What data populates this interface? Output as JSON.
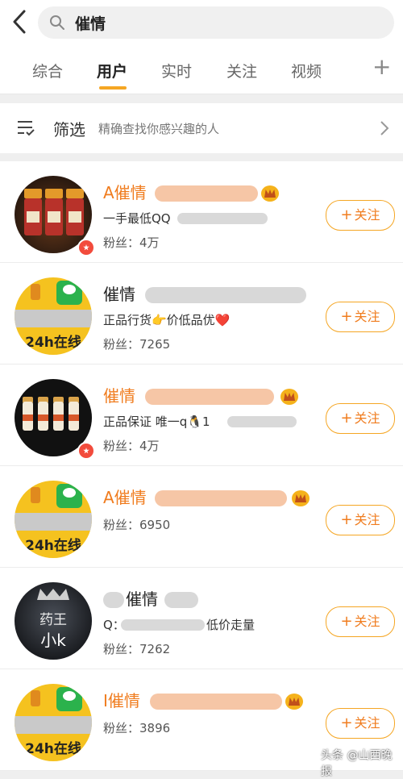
{
  "search": {
    "query": "催情"
  },
  "tabs": [
    {
      "label": "综合",
      "active": false
    },
    {
      "label": "用户",
      "active": true
    },
    {
      "label": "实时",
      "active": false
    },
    {
      "label": "关注",
      "active": false
    },
    {
      "label": "视频",
      "active": false
    }
  ],
  "tab_plus": "+",
  "filter": {
    "title": "筛选",
    "description": "精确查找你感兴趣的人"
  },
  "follow_label": "关注",
  "follow_plus": "+",
  "avatar_texts": {
    "online": "24h在线",
    "yao_line1": "药王",
    "yao_line2": "小k"
  },
  "users": [
    {
      "name": "A催情",
      "desc": "一手最低QQ",
      "fans": "粉丝：4万"
    },
    {
      "name": "催情",
      "desc": "正品行货👉价低品优❤️",
      "fans": "粉丝：7265"
    },
    {
      "name": "催情",
      "desc": "正品保证 唯一q🐧1",
      "fans": "粉丝：4万"
    },
    {
      "name": "A催情",
      "desc": "",
      "fans": "粉丝：6950"
    },
    {
      "name": "催情",
      "desc": "Q：",
      "desc2": "低价走量",
      "fans": "粉丝：7262"
    },
    {
      "name": "I催情",
      "desc": "",
      "fans": "粉丝：3896"
    }
  ],
  "watermark": "头条 @山西晚报",
  "colors": {
    "accent": "#f5a623",
    "name_orange": "#f07c1e"
  }
}
